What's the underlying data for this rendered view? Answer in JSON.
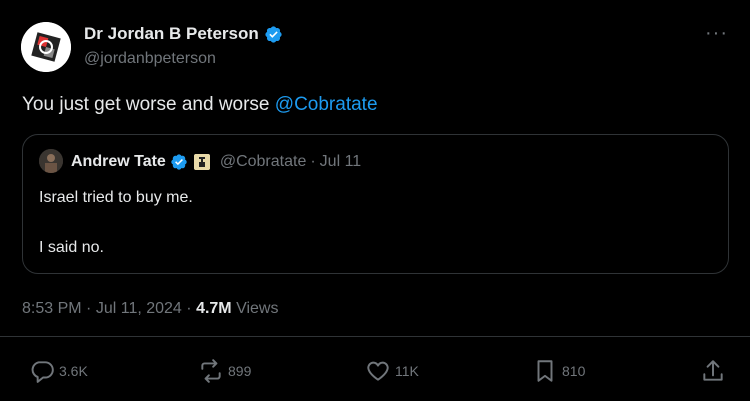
{
  "author": {
    "display_name": "Dr Jordan B Peterson",
    "handle": "@jordanbpeterson"
  },
  "tweet": {
    "text_prefix": "You just get worse and worse ",
    "mention": "@Cobratate"
  },
  "quote": {
    "display_name": "Andrew Tate",
    "handle": "@Cobratate",
    "separator": "·",
    "date": "Jul 11",
    "line1": "Israel tried to buy me.",
    "line2": "I said no."
  },
  "meta": {
    "time": "8:53 PM",
    "sep1": "·",
    "date": "Jul 11, 2024",
    "sep2": "·",
    "views_count": "4.7M",
    "views_label": "Views"
  },
  "actions": {
    "replies": "3.6K",
    "reposts": "899",
    "likes": "11K",
    "bookmarks": "810"
  },
  "colors": {
    "background": "#000000",
    "text": "#e7e9ea",
    "muted": "#71767b",
    "accent": "#1d9bf0",
    "border": "#2f3336"
  }
}
